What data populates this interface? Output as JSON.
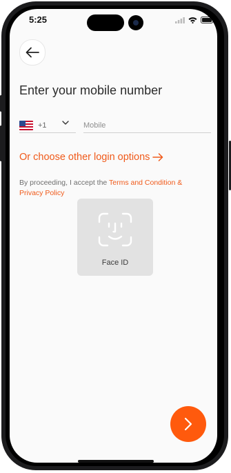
{
  "status": {
    "time": "5:25"
  },
  "header": {
    "back_icon": "arrow-left-icon"
  },
  "page": {
    "title": "Enter your mobile number"
  },
  "phone_input": {
    "country_flag": "us-flag-icon",
    "country_code": "+1",
    "mobile_placeholder": "Mobile",
    "mobile_value": ""
  },
  "login": {
    "other_options_label": "Or choose other login options"
  },
  "consent": {
    "prefix": "By proceeding, I accept the ",
    "links_text": "Terms and Condition & Privacy Policy"
  },
  "face_id": {
    "label": "Face ID"
  },
  "next_button": {
    "icon": "chevron-right-icon"
  },
  "colors": {
    "accent": "#f05a1a",
    "button": "#ff5a0d",
    "background": "#fafafa"
  }
}
